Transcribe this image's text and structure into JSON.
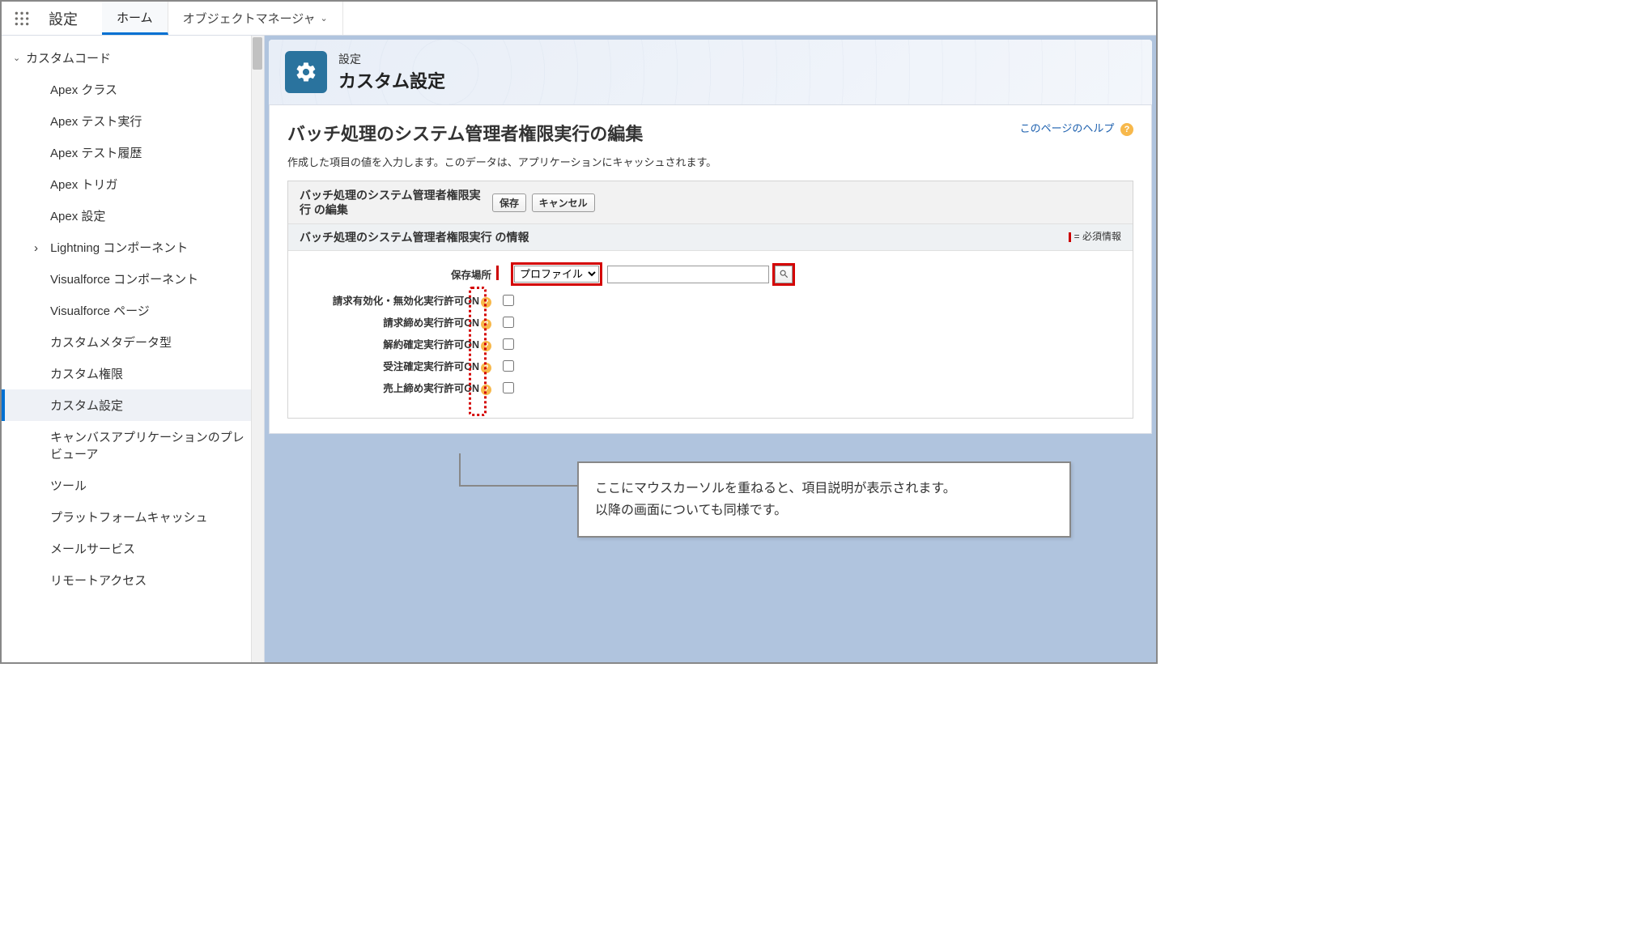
{
  "topbar": {
    "app_name": "設定",
    "tabs": [
      {
        "label": "ホーム",
        "active": true
      },
      {
        "label": "オブジェクトマネージャ",
        "active": false,
        "dropdown": true
      }
    ]
  },
  "sidebar": {
    "group_label": "カスタムコード",
    "items": [
      {
        "label": "Apex クラス"
      },
      {
        "label": "Apex テスト実行"
      },
      {
        "label": "Apex テスト履歴"
      },
      {
        "label": "Apex トリガ"
      },
      {
        "label": "Apex 設定"
      },
      {
        "label": "Lightning コンポーネント",
        "expandable": true
      },
      {
        "label": "Visualforce コンポーネント"
      },
      {
        "label": "Visualforce ページ"
      },
      {
        "label": "カスタムメタデータ型"
      },
      {
        "label": "カスタム権限"
      },
      {
        "label": "カスタム設定",
        "selected": true
      },
      {
        "label": "キャンバスアプリケーションのプレビューア"
      },
      {
        "label": "ツール"
      },
      {
        "label": "プラットフォームキャッシュ"
      },
      {
        "label": "メールサービス"
      },
      {
        "label": "リモートアクセス"
      }
    ]
  },
  "header": {
    "crumb": "設定",
    "title": "カスタム設定"
  },
  "content": {
    "h1": "バッチ処理のシステム管理者権限実行の編集",
    "help_link": "このページのヘルプ",
    "desc": "作成した項目の値を入力します。このデータは、アプリケーションにキャッシュされます。",
    "panel_title": "バッチ処理のシステム管理者権限実行 の編集",
    "btn_save": "保存",
    "btn_cancel": "キャンセル",
    "section_title": "バッチ処理のシステム管理者権限実行 の情報",
    "required_legend": "= 必須情報",
    "fields": {
      "location_label": "保存場所",
      "location_select_value": "プロファイル",
      "location_input_value": "",
      "rows": [
        {
          "label": "請求有効化・無効化実行許可ON"
        },
        {
          "label": "請求締め実行許可ON"
        },
        {
          "label": "解約確定実行許可ON"
        },
        {
          "label": "受注確定実行許可ON"
        },
        {
          "label": "売上締め実行許可ON"
        }
      ]
    }
  },
  "callout": {
    "line1": "ここにマウスカーソルを重ねると、項目説明が表示されます。",
    "line2": "以降の画面についても同様です。"
  }
}
